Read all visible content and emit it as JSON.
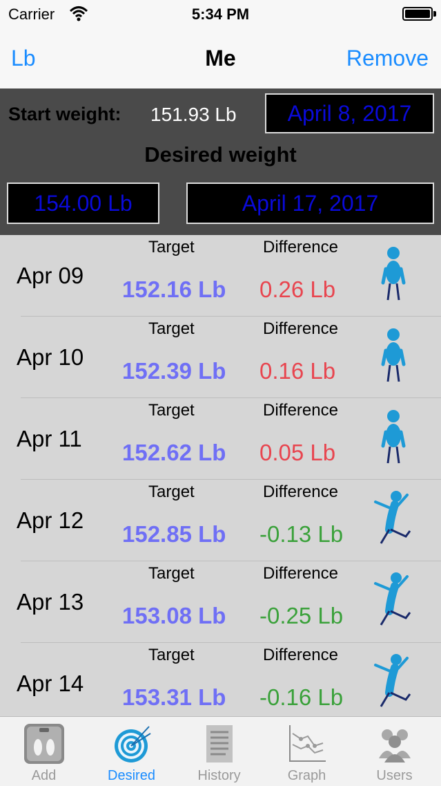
{
  "status": {
    "carrier": "Carrier",
    "time": "5:34 PM"
  },
  "nav": {
    "left": "Lb",
    "title": "Me",
    "right": "Remove"
  },
  "header": {
    "start_label": "Start weight:",
    "start_value": "151.93 Lb",
    "start_date": "April 8, 2017",
    "desired_label": "Desired weight",
    "desired_value": "154.00 Lb",
    "desired_date": "April 17, 2017"
  },
  "rows": [
    {
      "date": "Apr 09",
      "target_label": "Target",
      "diff_label": "Difference",
      "target": "152.16 Lb",
      "diff": "0.26 Lb",
      "diff_color": "#e8454f",
      "figure": "standing-figure-icon"
    },
    {
      "date": "Apr 10",
      "target_label": "Target",
      "diff_label": "Difference",
      "target": "152.39 Lb",
      "diff": "0.16 Lb",
      "diff_color": "#e8454f",
      "figure": "standing-figure-icon"
    },
    {
      "date": "Apr 11",
      "target_label": "Target",
      "diff_label": "Difference",
      "target": "152.62 Lb",
      "diff": "0.05 Lb",
      "diff_color": "#e8454f",
      "figure": "standing-figure-icon"
    },
    {
      "date": "Apr 12",
      "target_label": "Target",
      "diff_label": "Difference",
      "target": "152.85 Lb",
      "diff": "-0.13 Lb",
      "diff_color": "#3aa13a",
      "figure": "jumping-figure-icon"
    },
    {
      "date": "Apr 13",
      "target_label": "Target",
      "diff_label": "Difference",
      "target": "153.08 Lb",
      "diff": "-0.25 Lb",
      "diff_color": "#3aa13a",
      "figure": "jumping-figure-icon"
    },
    {
      "date": "Apr 14",
      "target_label": "Target",
      "diff_label": "Difference",
      "target": "153.31 Lb",
      "diff": "-0.16 Lb",
      "diff_color": "#3aa13a",
      "figure": "jumping-figure-icon"
    }
  ],
  "tabs": [
    {
      "label": "Add",
      "icon": "footprint-scale-icon",
      "active": false
    },
    {
      "label": "Desired",
      "icon": "target-icon",
      "active": true
    },
    {
      "label": "History",
      "icon": "document-icon",
      "active": false
    },
    {
      "label": "Graph",
      "icon": "graph-icon",
      "active": false
    },
    {
      "label": "Users",
      "icon": "users-icon",
      "active": false
    }
  ],
  "colors": {
    "accent": "#1a8cff",
    "target_value": "#6f6ff5",
    "positive_diff": "#e8454f",
    "negative_diff": "#3aa13a",
    "date_box_text": "#0a0ad9"
  }
}
